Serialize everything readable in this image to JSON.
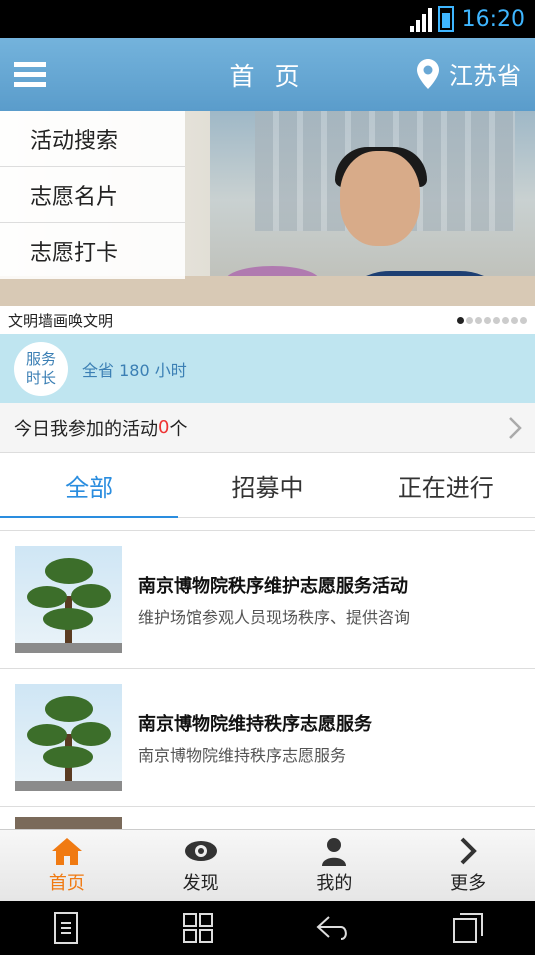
{
  "status_bar": {
    "time": "16:20"
  },
  "header": {
    "title": "首 页",
    "location": "江苏省"
  },
  "side_menu": {
    "items": [
      "活动搜索",
      "志愿名片",
      "志愿打卡"
    ]
  },
  "banner": {
    "caption": "文明墙画唤文明"
  },
  "service": {
    "badge_line1": "服务",
    "badge_line2": "时长",
    "text": "全省 180 小时"
  },
  "today": {
    "label": "今日我参加的活动",
    "count": "0",
    "unit": "个"
  },
  "tabs": [
    "全部",
    "招募中",
    "正在进行"
  ],
  "activities": [
    {
      "title": "南京博物院秩序维护志愿服务活动",
      "subtitle": "维护场馆参观人员现场秩序、提供咨询"
    },
    {
      "title": "南京博物院维持秩序志愿服务",
      "subtitle": "南京博物院维持秩序志愿服务"
    }
  ],
  "tab_bar": [
    {
      "label": "首页",
      "icon": "home-icon"
    },
    {
      "label": "发现",
      "icon": "eye-icon"
    },
    {
      "label": "我的",
      "icon": "person-icon"
    },
    {
      "label": "更多",
      "icon": "chevron-right-icon"
    }
  ],
  "colors": {
    "header": "#6aa8d5",
    "accent": "#2a8ddf",
    "active_tab_bar": "#f07a12",
    "service_bg": "#bfe5f0"
  }
}
